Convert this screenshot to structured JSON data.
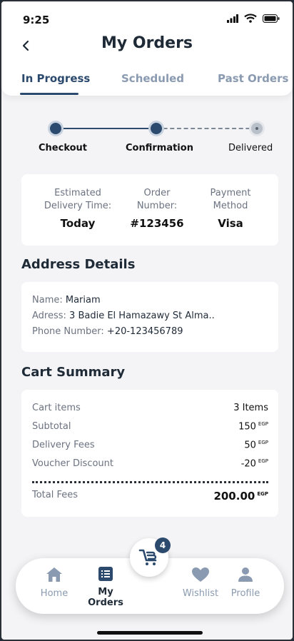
{
  "status": {
    "time": "9:25"
  },
  "header": {
    "title": "My Orders"
  },
  "tabs": [
    {
      "label": "In Progress",
      "active": true
    },
    {
      "label": "Scheduled",
      "active": false
    },
    {
      "label": "Past Orders",
      "active": false
    }
  ],
  "progress": {
    "steps": [
      {
        "label": "Checkout",
        "done": true
      },
      {
        "label": "Confirmation",
        "done": true
      },
      {
        "label": "Delivered",
        "done": false
      }
    ]
  },
  "order_info": {
    "delivery": {
      "label": "Estimated Delivery Time:",
      "value": "Today"
    },
    "number": {
      "label": "Order Number:",
      "value": "#123456"
    },
    "payment": {
      "label": "Payment Method",
      "value": "Visa"
    }
  },
  "address": {
    "title": "Address Details",
    "name_label": "Name:",
    "name_value": "Mariam",
    "address_label": "Adress:",
    "address_value": "3 Badie El Hamazawy St Alma..",
    "phone_label": "Phone Number:",
    "phone_value": "+20-123456789"
  },
  "cart": {
    "title": "Cart Summary",
    "items_label": "Cart items",
    "items_value": "3 Items",
    "subtotal_label": "Subtotal",
    "subtotal_value": "150",
    "delivery_label": "Delivery Fees",
    "delivery_value": "50",
    "voucher_label": "Voucher Discount",
    "voucher_value": "-20",
    "total_label": "Total Fees",
    "total_value": "200.00",
    "currency": "EGP"
  },
  "nav": {
    "home": "Home",
    "orders": "My Orders",
    "wishlist": "Wishlist",
    "profile": "Profile",
    "cart_badge": "4"
  },
  "colors": {
    "primary": "#2c4a6e",
    "muted": "#8a9ab0",
    "negative": "#d0443a"
  }
}
